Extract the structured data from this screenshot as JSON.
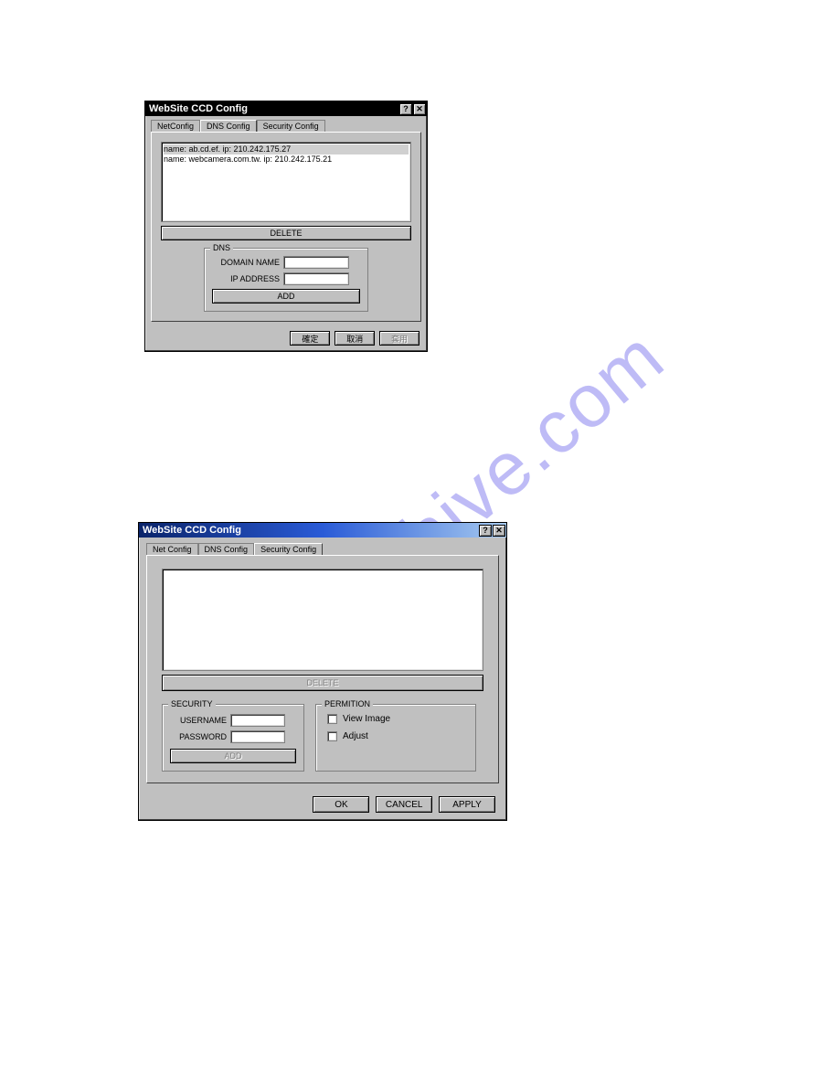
{
  "watermark_text": "manualshive.com",
  "dialog1": {
    "title": "WebSite CCD Config",
    "help_btn": "?",
    "close_btn": "✕",
    "tabs": [
      "NetConfig",
      "DNS Config",
      "Security Config"
    ],
    "active_tab_index": 1,
    "list_rows": [
      "name: ab.cd.ef.   ip: 210.242.175.27",
      "name: webcamera.com.tw.   ip: 210.242.175.21"
    ],
    "delete_label": "DELETE",
    "dns_group_label": "DNS",
    "domain_name_label": "DOMAIN NAME",
    "ip_address_label": "IP ADDRESS",
    "add_label": "ADD",
    "bottom_buttons": [
      "確定",
      "取消",
      "套用"
    ]
  },
  "dialog2": {
    "title": "WebSite CCD Config",
    "help_btn": "?",
    "close_btn": "✕",
    "tabs": [
      "Net Config",
      "DNS Config",
      "Security Config"
    ],
    "active_tab_index": 2,
    "delete_label": "DELETE",
    "security_group_label": "SECURITY",
    "username_label": "USERNAME",
    "password_label": "PASSWORD",
    "add_label": "ADD",
    "permition_group_label": "PERMITION",
    "view_image_label": "View Image",
    "adjust_label": "Adjust",
    "bottom_buttons": [
      "OK",
      "CANCEL",
      "APPLY"
    ]
  }
}
